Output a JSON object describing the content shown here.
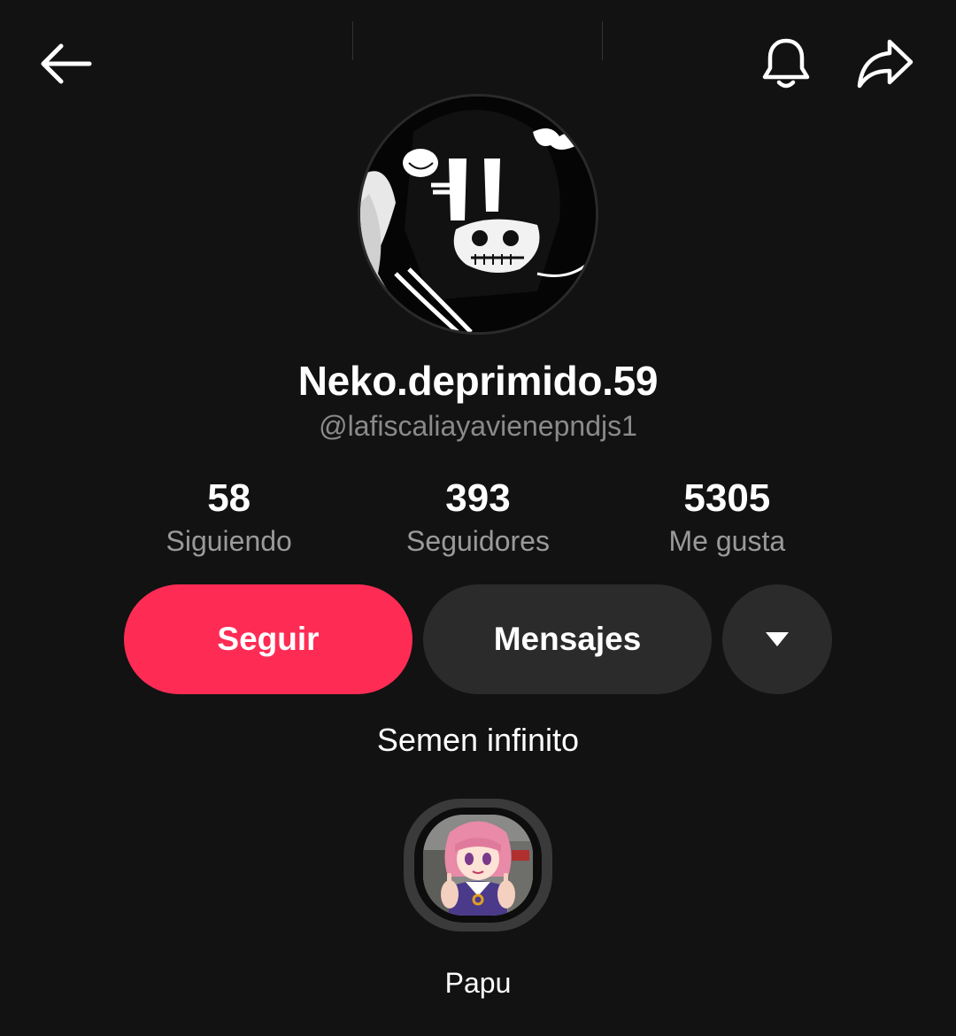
{
  "header": {
    "back_icon": "arrow-left-icon",
    "notify_icon": "bell-icon",
    "share_icon": "share-arrow-icon"
  },
  "profile": {
    "display_name": "Neko.deprimido.59",
    "handle": "@lafiscaliayavienepndjs1",
    "bio": "Semen infinito"
  },
  "stats": [
    {
      "value": "58",
      "label": "Siguiendo"
    },
    {
      "value": "393",
      "label": "Seguidores"
    },
    {
      "value": "5305",
      "label": "Me gusta"
    }
  ],
  "actions": {
    "follow_label": "Seguir",
    "message_label": "Mensajes",
    "more_icon": "caret-down-icon"
  },
  "highlights": [
    {
      "label": "Papu"
    }
  ],
  "colors": {
    "background": "#121212",
    "accent": "#fe2c55",
    "secondary_button": "#2b2b2b",
    "muted_text": "#8a8a8a"
  }
}
